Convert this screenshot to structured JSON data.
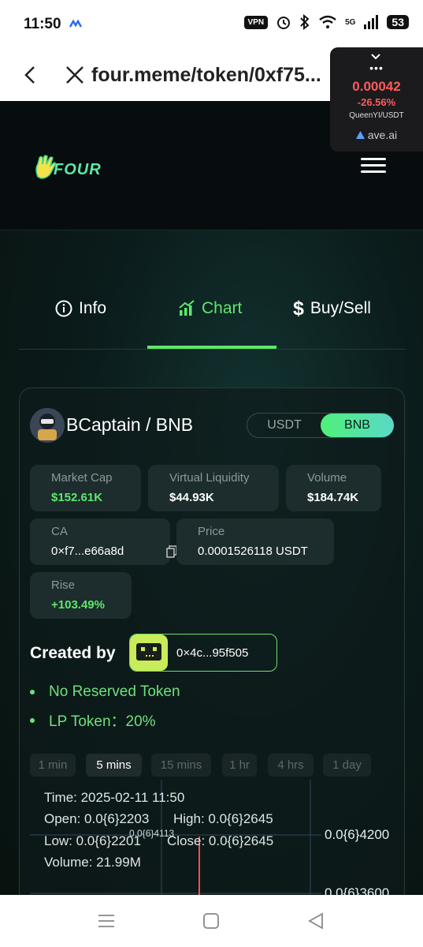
{
  "status_bar": {
    "time": "11:50",
    "vpn": "VPN",
    "network": "5G",
    "battery": "53"
  },
  "browser": {
    "url": "four.meme/token/0xf75..."
  },
  "widget": {
    "price": "0.00042",
    "change": "-26.56%",
    "pair": "QueenYI/USDT",
    "source": "ave.ai",
    "dots": "•••"
  },
  "header": {
    "logo_text": "FOUR"
  },
  "tabs": [
    {
      "label": "Info"
    },
    {
      "label": "Chart"
    },
    {
      "label": "Buy/Sell"
    }
  ],
  "token": {
    "pair_name": "BCaptain / BNB",
    "toggle": {
      "usdt": "USDT",
      "bnb": "BNB",
      "selected": "BNB"
    }
  },
  "stats": {
    "market_cap": {
      "label": "Market Cap",
      "value": "$152.61K"
    },
    "virtual_liquidity": {
      "label": "Virtual Liquidity",
      "value": "$44.93K"
    },
    "volume": {
      "label": "Volume",
      "value": "$184.74K"
    },
    "ca": {
      "label": "CA",
      "value": "0×f7...e66a8d"
    },
    "price": {
      "label": "Price",
      "value": "0.0001526118 USDT"
    },
    "rise": {
      "label": "Rise",
      "value": "+103.49%"
    }
  },
  "creator": {
    "label": "Created by",
    "address": "0×4c...95f505"
  },
  "features": [
    "No Reserved Token",
    "LP Token：20%"
  ],
  "timeframes": [
    {
      "label": "1 min"
    },
    {
      "label": "5 mins"
    },
    {
      "label": "15 mins"
    },
    {
      "label": "1 hr"
    },
    {
      "label": "4 hrs"
    },
    {
      "label": "1 day"
    }
  ],
  "selected_timeframe": "5 mins",
  "chart": {
    "time": "Time: 2025-02-11 11:50",
    "open": "Open: 0.0{6}2203",
    "high": "High: 0.0{6}2645",
    "low": "Low: 0.0{6}2201",
    "close": "Close: 0.0{6}2645",
    "volume": "Volume: 21.99M",
    "crosshair_label": "0.0{6}4113",
    "y_labels": [
      "0.0{6}4200",
      "0.0{6}3600"
    ]
  },
  "colors": {
    "accent": "#5ee86a",
    "negative": "#ff5b5b",
    "background": "#0a1114"
  }
}
